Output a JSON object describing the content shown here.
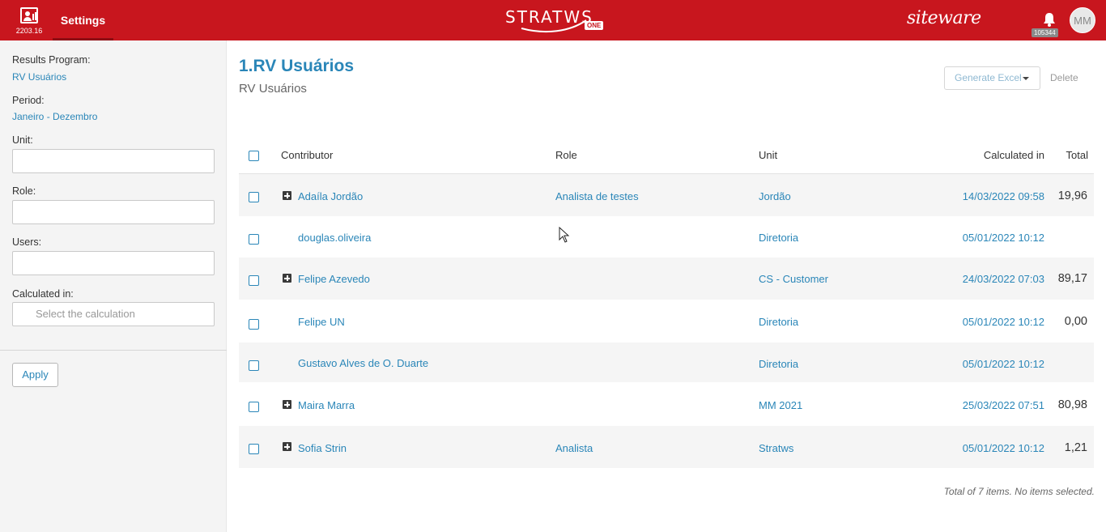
{
  "topbar": {
    "version": "2203.16",
    "settings_label": "Settings",
    "brand_name": "STRATWS",
    "brand_badge": "ONE",
    "vendor_name": "siteware",
    "notification_count": "105344",
    "user_initials": "MM",
    "accent_color": "#c8161e"
  },
  "sidebar": {
    "program_label": "Results Program:",
    "program_value": "RV Usuários",
    "period_label": "Period:",
    "period_value": "Janeiro - Dezembro",
    "unit_label": "Unit:",
    "unit_value": "",
    "role_label": "Role:",
    "role_value": "",
    "users_label": "Users:",
    "users_value": "",
    "calc_label": "Calculated in:",
    "calc_placeholder": "Select the calculation",
    "apply_label": "Apply"
  },
  "main": {
    "title": "1.RV Usuários",
    "subtitle": "RV Usuários",
    "excel_label": "Generate Excel",
    "delete_label": "Delete",
    "columns": {
      "contributor": "Contributor",
      "role": "Role",
      "unit": "Unit",
      "calculated": "Calculated in",
      "total": "Total"
    },
    "rows": [
      {
        "contributor": "Adaíla Jordão",
        "role": "Analista de testes",
        "unit": "Jordão",
        "calculated": "14/03/2022 09:58",
        "total": "19,96"
      },
      {
        "contributor": "douglas.oliveira",
        "role": "",
        "unit": "Diretoria",
        "calculated": "05/01/2022 10:12",
        "total": ""
      },
      {
        "contributor": "Felipe Azevedo",
        "role": "",
        "unit": "CS - Customer",
        "calculated": "24/03/2022 07:03",
        "total": "89,17"
      },
      {
        "contributor": "Felipe UN",
        "role": "",
        "unit": "Diretoria",
        "calculated": "05/01/2022 10:12",
        "total": "0,00"
      },
      {
        "contributor": "Gustavo Alves de O. Duarte",
        "role": "",
        "unit": "Diretoria",
        "calculated": "05/01/2022 10:12",
        "total": ""
      },
      {
        "contributor": "Maira Marra",
        "role": "",
        "unit": "MM 2021",
        "calculated": "25/03/2022 07:51",
        "total": "80,98"
      },
      {
        "contributor": "Sofia Strin",
        "role": "Analista",
        "unit": "Stratws",
        "calculated": "05/01/2022 10:12",
        "total": "1,21"
      }
    ],
    "footer": "Total of 7 items. No items selected."
  }
}
